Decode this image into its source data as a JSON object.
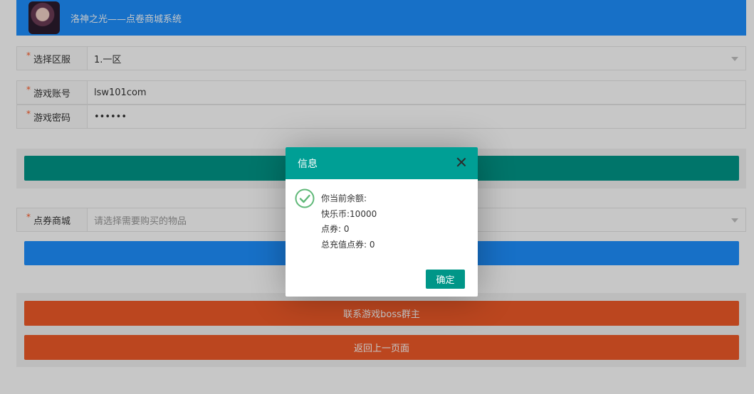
{
  "header": {
    "title": "洛神之光——点卷商城系统"
  },
  "form": {
    "server": {
      "label": "选择区服",
      "value": "1.一区"
    },
    "account": {
      "label": "游戏账号",
      "value": "lsw101com"
    },
    "password": {
      "label": "游戏密码",
      "value": "••••••"
    },
    "shop": {
      "label": "点券商城",
      "placeholder": "请选择需要购买的物品"
    }
  },
  "buttons": {
    "contact": "联系游戏boss群主",
    "back": "返回上一页面"
  },
  "dialog": {
    "title": "信息",
    "lines": [
      "你当前余额:",
      "快乐币:10000",
      "点券: 0",
      "总充值点券: 0"
    ],
    "ok": "确定"
  },
  "colors": {
    "header": "#1e90ff",
    "green": "#009688",
    "red": "#f05a28",
    "required": "#ff5722"
  }
}
